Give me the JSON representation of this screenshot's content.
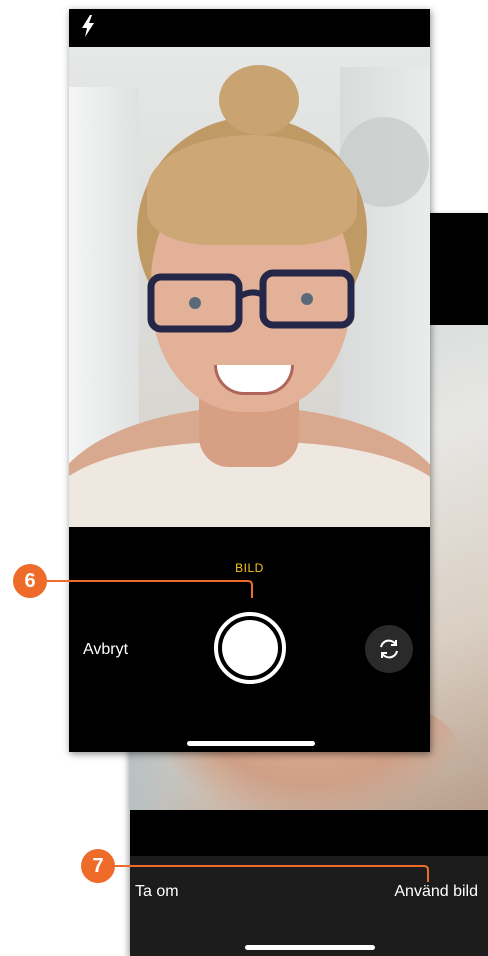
{
  "camera": {
    "mode_label": "BILD",
    "cancel_label": "Avbryt",
    "icons": {
      "flash": "flash-icon",
      "shutter": "shutter-button-icon",
      "flip": "flip-camera-icon"
    }
  },
  "review": {
    "retake_label": "Ta om",
    "use_label": "Använd bild"
  },
  "callouts": [
    {
      "number": "6"
    },
    {
      "number": "7"
    }
  ],
  "colors": {
    "accent_callout": "#ee6b2a",
    "mode_label": "#f5c518",
    "background": "#000000"
  }
}
